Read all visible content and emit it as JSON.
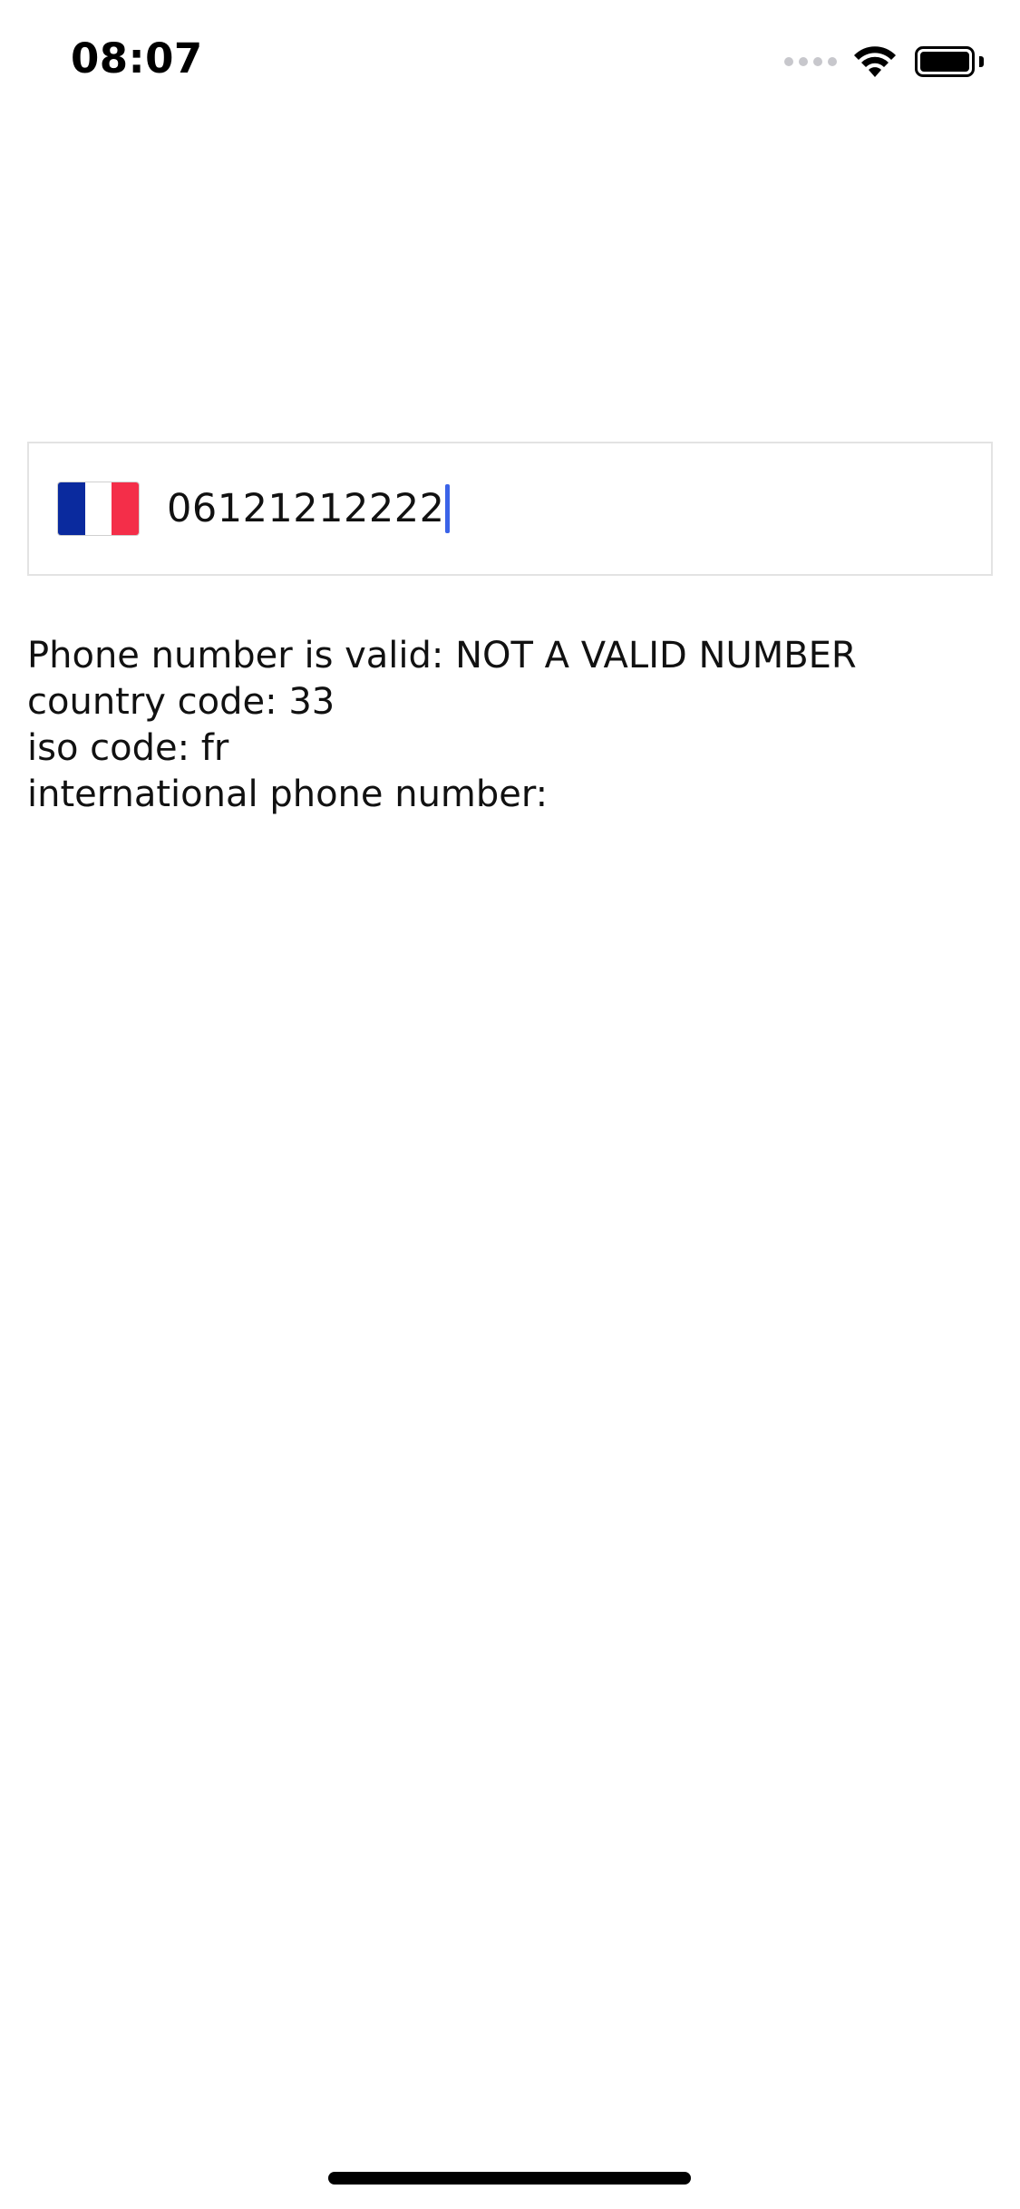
{
  "status_bar": {
    "time": "08:07",
    "icons": [
      "signal-icon",
      "wifi-icon",
      "battery-icon"
    ]
  },
  "phone_input": {
    "flag_icon": "france-flag-icon",
    "flag_colors": [
      "#0a2a9e",
      "#ffffff",
      "#f42e49"
    ],
    "value": "06121212222",
    "caret_color": "#3a63e8"
  },
  "info": {
    "valid_line": "Phone number is valid: NOT A VALID NUMBER",
    "country_code_line": "country code: 33",
    "iso_code_line": "iso code: fr",
    "international_line": "international phone number:"
  }
}
